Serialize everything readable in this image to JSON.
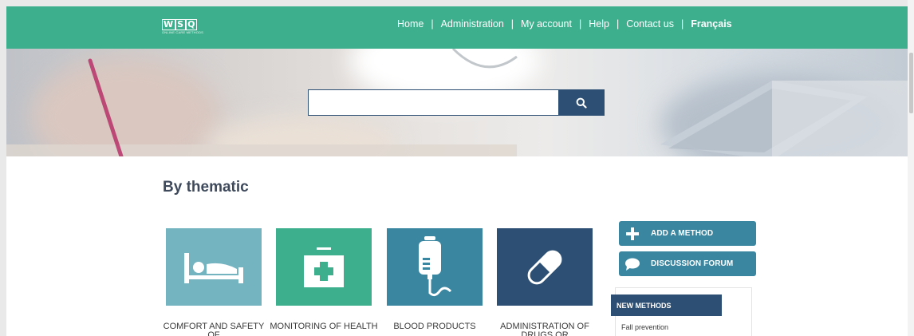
{
  "header": {
    "logo_text": "WSQ",
    "logo_subtitle": "ONLINE CARE METHODS",
    "nav": [
      {
        "label": "Home"
      },
      {
        "label": "Administration"
      },
      {
        "label": "My account"
      },
      {
        "label": "Help"
      },
      {
        "label": "Contact us"
      },
      {
        "label": "Français"
      }
    ],
    "nav_separator": "|"
  },
  "search": {
    "placeholder": "",
    "button_icon": "search-icon"
  },
  "main": {
    "section_title": "By thematic",
    "tiles": [
      {
        "label": "COMFORT AND SAFETY OF",
        "icon": "bed-icon",
        "color": "#74b3c0"
      },
      {
        "label": "MONITORING OF HEALTH",
        "icon": "first-aid-kit-icon",
        "color": "#3daf8c"
      },
      {
        "label": "BLOOD PRODUCTS",
        "icon": "blood-bag-icon",
        "color": "#3a86a0"
      },
      {
        "label": "ADMINISTRATION OF DRUGS OR",
        "icon": "pill-icon",
        "color": "#2c4f73"
      }
    ]
  },
  "sidebar": {
    "add_method": {
      "label": "ADD A METHOD",
      "icon": "plus-icon"
    },
    "forum": {
      "label": "DISCUSSION FORUM",
      "icon": "speech-bubble-icon"
    },
    "new_methods": {
      "title": "NEW METHODS",
      "items": [
        "Fall prevention"
      ]
    }
  },
  "colors": {
    "header_green": "#3daf8c",
    "navy": "#2c4f73",
    "teal": "#3a86a0",
    "light_teal": "#74b3c0"
  }
}
